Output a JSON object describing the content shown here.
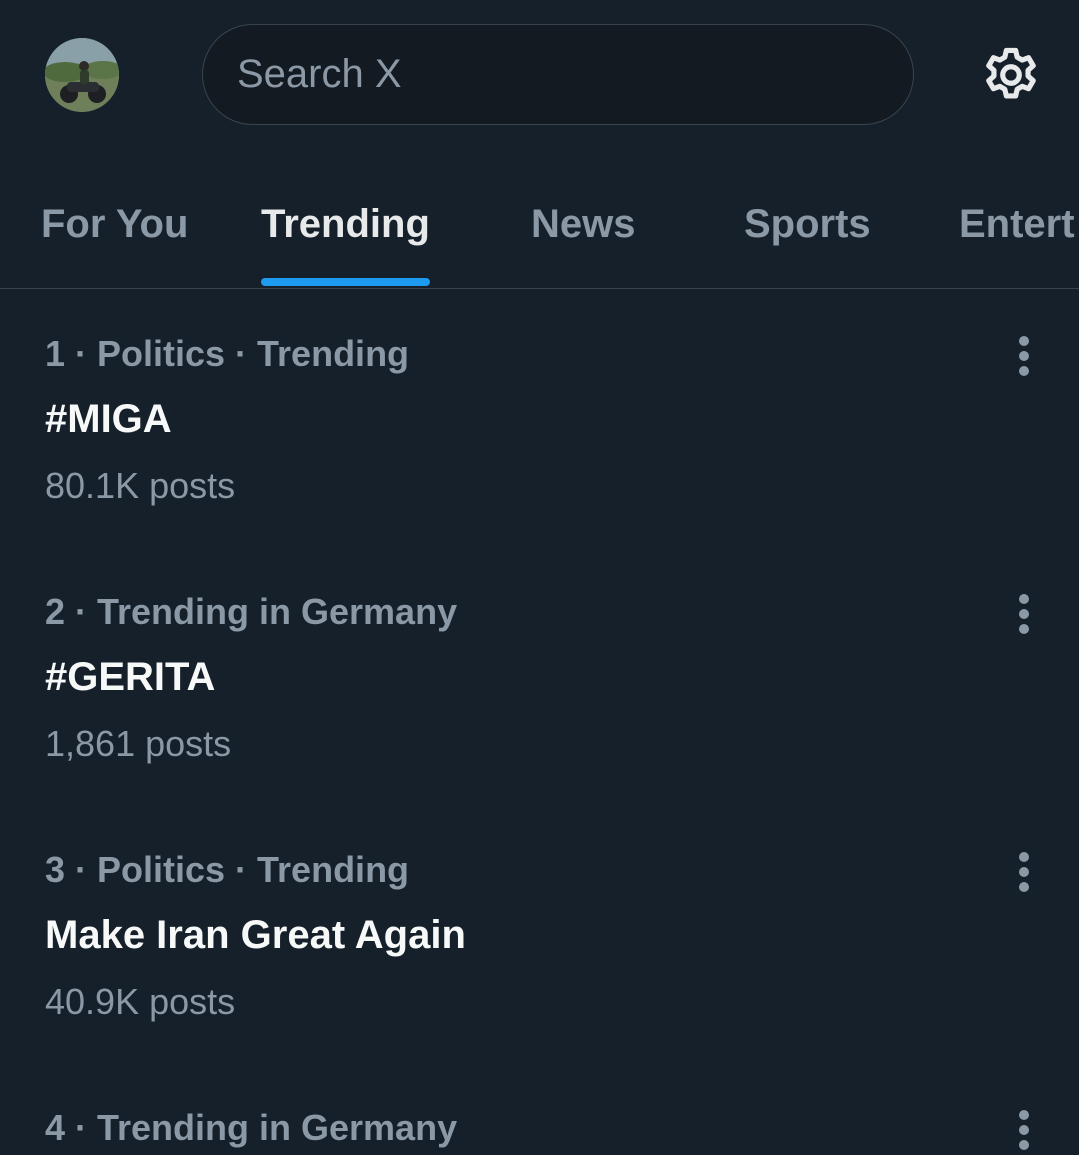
{
  "header": {
    "avatar_icon": "profile-avatar",
    "search": {
      "placeholder": "Search X",
      "value": ""
    },
    "settings_icon": "gear-icon"
  },
  "tabs": [
    {
      "label": "For You",
      "active": false
    },
    {
      "label": "Trending",
      "active": true
    },
    {
      "label": "News",
      "active": false
    },
    {
      "label": "Sports",
      "active": false
    },
    {
      "label": "Entert",
      "active": false
    }
  ],
  "trends": [
    {
      "meta": "1 · Politics · Trending",
      "title": "#MIGA",
      "posts": "80.1K posts"
    },
    {
      "meta": "2 · Trending in Germany",
      "title": "#GERITA",
      "posts": "1,861 posts"
    },
    {
      "meta": "3 · Politics · Trending",
      "title": "Make Iran Great Again",
      "posts": "40.9K posts"
    },
    {
      "meta": "4 · Trending in Germany",
      "title": "",
      "posts": ""
    }
  ],
  "colors": {
    "background": "#15202b",
    "accent": "#1d9bf0",
    "secondary_text": "#8b98a5",
    "primary_text": "#e7e9ea"
  }
}
